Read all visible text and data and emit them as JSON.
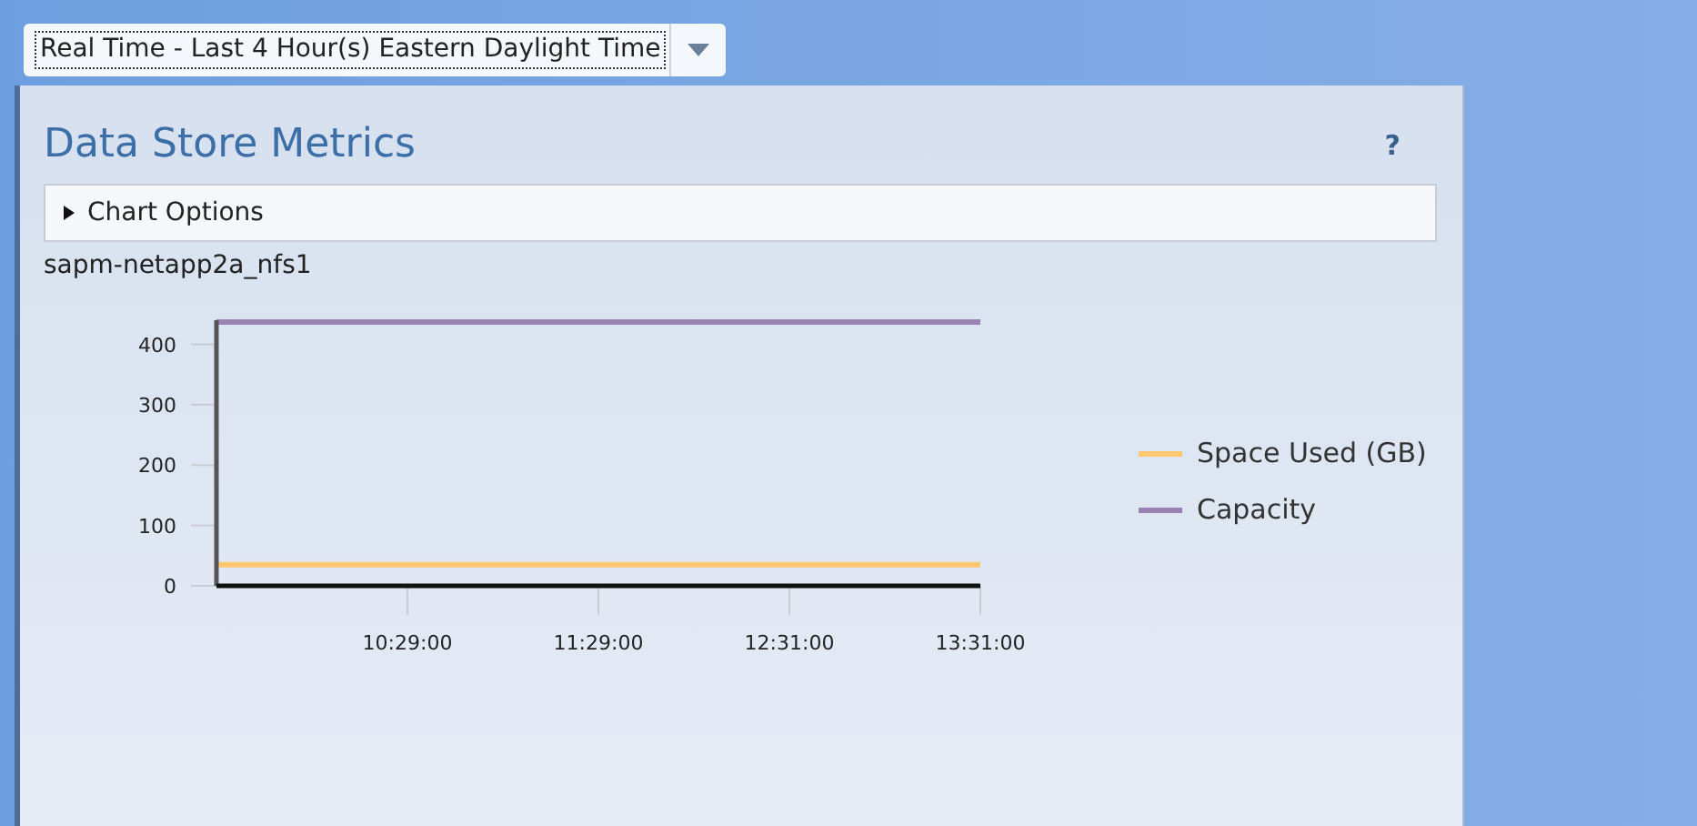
{
  "time_range": {
    "value": "Real Time - Last 4 Hour(s) Eastern Daylight Time"
  },
  "panel": {
    "title": "Data Store Metrics",
    "help": "?",
    "chart_options": {
      "label": "Chart Options",
      "expanded": false
    },
    "datastore": "sapm-netapp2a_nfs1",
    "chart_data": {
      "type": "line",
      "categories": [
        null,
        "10:29:00",
        "11:29:00",
        "12:31:00",
        "13:31:00"
      ],
      "yticks": [
        0,
        100,
        200,
        300,
        400
      ],
      "ylim": [
        0,
        440
      ],
      "series": [
        {
          "name": "Space Used (GB)",
          "color": "#ffc86e",
          "values": [
            35,
            35,
            35,
            35,
            35
          ]
        },
        {
          "name": "Capacity",
          "color": "#9b82b4",
          "values": [
            437,
            437,
            437,
            437,
            437
          ]
        }
      ]
    }
  }
}
